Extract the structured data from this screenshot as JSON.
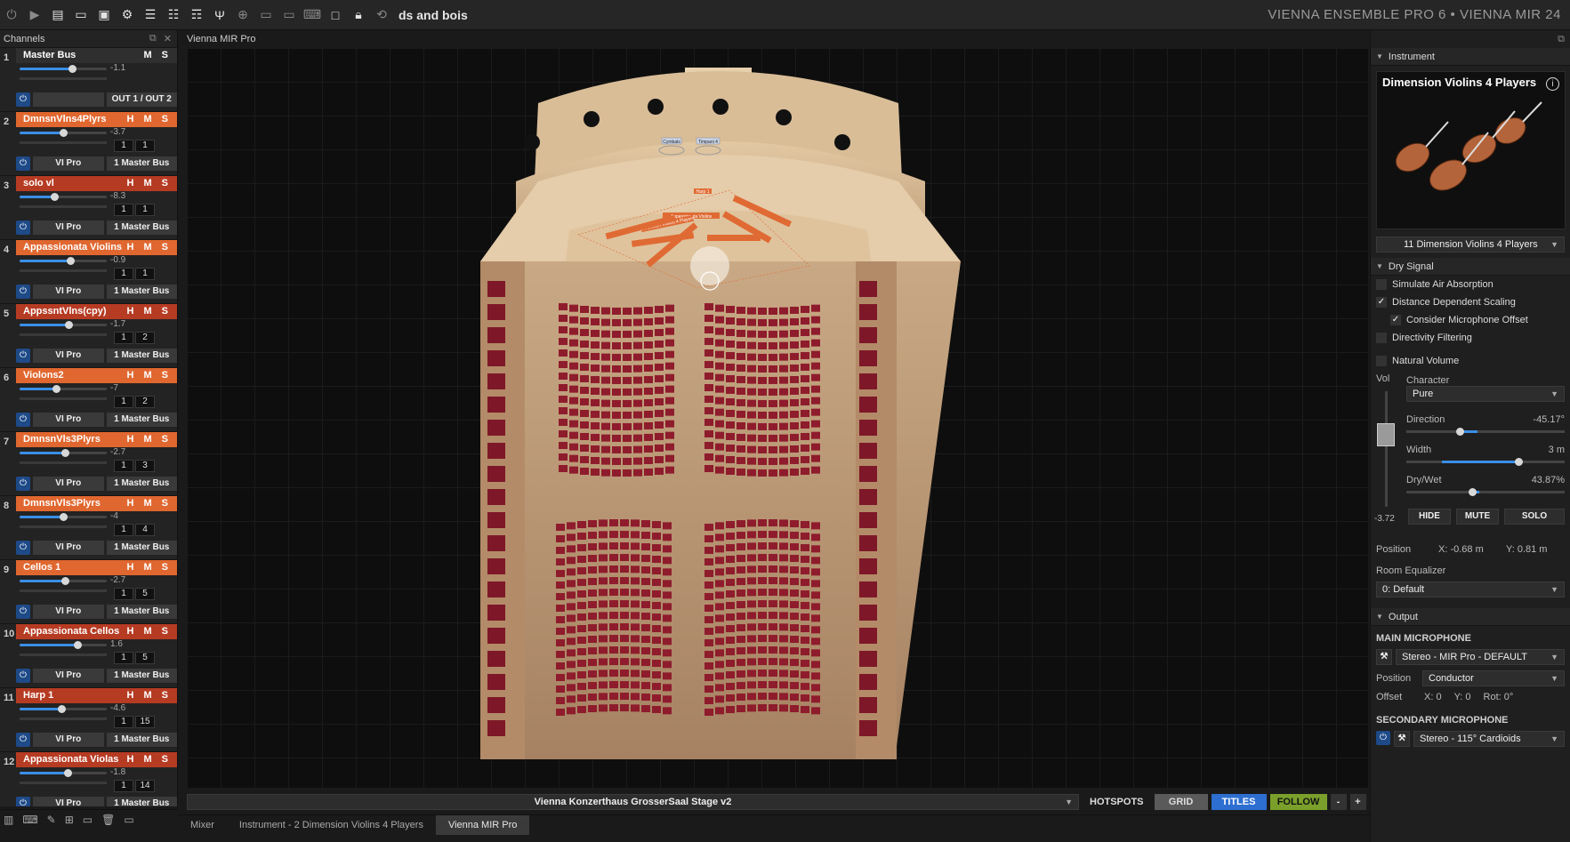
{
  "toolbar": {
    "project_name": "ds and bois",
    "app_title": "VIENNA ENSEMBLE PRO 6 • VIENNA MIR 24",
    "icons": [
      "power-icon",
      "play-icon",
      "new-icon",
      "open-icon",
      "save-icon",
      "settings-icon",
      "db-icon",
      "db2-icon",
      "db3-icon",
      "tuning-fork-icon",
      "crosshair-icon",
      "mir-icon",
      "mir2-icon",
      "keyboard-icon",
      "window-icon",
      "lock-icon",
      "link-icon"
    ]
  },
  "channels": {
    "title": "Channels",
    "items": [
      {
        "num": "1",
        "name": "Master Bus",
        "flags": "M S",
        "vol": "-1.1",
        "style": "neutral",
        "fill": 0.6,
        "in": "",
        "out": "",
        "plugin": "",
        "route": "OUT 1 / OUT 2"
      },
      {
        "num": "2",
        "name": "DmnsnVlns4Plyrs",
        "flags": "H M S",
        "vol": "-3.7",
        "style": "orange",
        "fill": 0.5,
        "in": "1",
        "out": "1",
        "plugin": "VI Pro",
        "route": "1 Master Bus"
      },
      {
        "num": "3",
        "name": "solo vl",
        "flags": "H M S",
        "vol": "-8.3",
        "style": "dark",
        "fill": 0.4,
        "in": "1",
        "out": "1",
        "plugin": "VI Pro",
        "route": "1 Master Bus"
      },
      {
        "num": "4",
        "name": "Appassionata Violins",
        "flags": "H M S",
        "vol": "-0.9",
        "style": "orange",
        "fill": 0.58,
        "in": "1",
        "out": "1",
        "plugin": "VI Pro",
        "route": "1 Master Bus"
      },
      {
        "num": "5",
        "name": "AppssntVlns(cpy)",
        "flags": "H M S",
        "vol": "-1.7",
        "style": "dark",
        "fill": 0.56,
        "in": "1",
        "out": "2",
        "plugin": "VI Pro",
        "route": "1 Master Bus"
      },
      {
        "num": "6",
        "name": "Violons2",
        "flags": "H M S",
        "vol": "-7",
        "style": "orange",
        "fill": 0.42,
        "in": "1",
        "out": "2",
        "plugin": "VI Pro",
        "route": "1 Master Bus"
      },
      {
        "num": "7",
        "name": "DmnsnVls3Plyrs",
        "flags": "H M S",
        "vol": "-2.7",
        "style": "orange",
        "fill": 0.52,
        "in": "1",
        "out": "3",
        "plugin": "VI Pro",
        "route": "1 Master Bus"
      },
      {
        "num": "8",
        "name": "DmnsnVls3Plyrs",
        "flags": "H M S",
        "vol": "-4",
        "style": "orange",
        "fill": 0.5,
        "in": "1",
        "out": "4",
        "plugin": "VI Pro",
        "route": "1 Master Bus"
      },
      {
        "num": "9",
        "name": "Cellos 1",
        "flags": "H M S",
        "vol": "-2.7",
        "style": "orange",
        "fill": 0.52,
        "in": "1",
        "out": "5",
        "plugin": "VI Pro",
        "route": "1 Master Bus"
      },
      {
        "num": "10",
        "name": "Appassionata Cellos",
        "flags": "H M S",
        "vol": "1.6",
        "style": "dark",
        "fill": 0.66,
        "in": "1",
        "out": "5",
        "plugin": "VI Pro",
        "route": "1 Master Bus"
      },
      {
        "num": "11",
        "name": "Harp 1",
        "flags": "H M S",
        "vol": "-4.6",
        "style": "dark",
        "fill": 0.48,
        "in": "1",
        "out": "15",
        "plugin": "VI Pro",
        "route": "1 Master Bus"
      },
      {
        "num": "12",
        "name": "Appassionata Violas",
        "flags": "H M S",
        "vol": "-1.8",
        "style": "dark",
        "fill": 0.55,
        "in": "1",
        "out": "14",
        "plugin": "VI Pro",
        "route": "1 Master Bus"
      }
    ]
  },
  "main": {
    "title": "Vienna MIR Pro",
    "preset": "Vienna Konzerthaus GrosserSaal Stage v2",
    "buttons": {
      "hotspots": "HOTSPOTS",
      "grid": "GRID",
      "titles": "TITLES",
      "follow": "FOLLOW",
      "minus": "-",
      "plus": "+"
    },
    "stage_labels": {
      "cymbals": "Cymbals",
      "timpani": "Timpani 4",
      "harp": "Harp 1",
      "appassionata": "Appassionata Violins",
      "dimension": "Dimension Violins 4 Players"
    }
  },
  "tabs": [
    {
      "label": "Mixer",
      "active": false
    },
    {
      "label": "Instrument - 2 Dimension Violins 4 Players",
      "active": false
    },
    {
      "label": "Vienna MIR Pro",
      "active": true
    }
  ],
  "inspector": {
    "instrument_head": "Instrument",
    "instrument_title": "Dimension Violins 4 Players",
    "instrument_select": "11 Dimension Violins 4 Players",
    "dry_signal_head": "Dry Signal",
    "checks": {
      "air": {
        "label": "Simulate Air Absorption",
        "checked": false
      },
      "distance": {
        "label": "Distance Dependent Scaling",
        "checked": true
      },
      "mic_offset": {
        "label": "Consider Microphone Offset",
        "checked": true
      },
      "directivity": {
        "label": "Directivity Filtering",
        "checked": false
      },
      "natural": {
        "label": "Natural Volume",
        "checked": false
      }
    },
    "vol_label": "Vol",
    "vol_value": "-3.72",
    "character_label": "Character",
    "character_value": "Pure",
    "direction_label": "Direction",
    "direction_value": "-45.17°",
    "width_label": "Width",
    "width_value": "3 m",
    "drywet_label": "Dry/Wet",
    "drywet_value": "43.87%",
    "hide": "HIDE",
    "mute": "MUTE",
    "solo": "SOLO",
    "position_label": "Position",
    "pos_x": "X:  -0.68 m",
    "pos_y": "Y:  0.81 m",
    "room_eq_label": "Room Equalizer",
    "room_eq_value": "0: Default",
    "output_head": "Output",
    "main_mic_head": "MAIN MICROPHONE",
    "main_mic_value": "Stereo - MIR Pro - DEFAULT",
    "mic_position_label": "Position",
    "mic_position_value": "Conductor",
    "offset_label": "Offset",
    "offset_x": "X:  0",
    "offset_y": "Y:  0",
    "offset_rot": "Rot:  0°",
    "secondary_mic_head": "SECONDARY MICROPHONE",
    "secondary_mic_value": "Stereo - 115° Cardioids"
  }
}
